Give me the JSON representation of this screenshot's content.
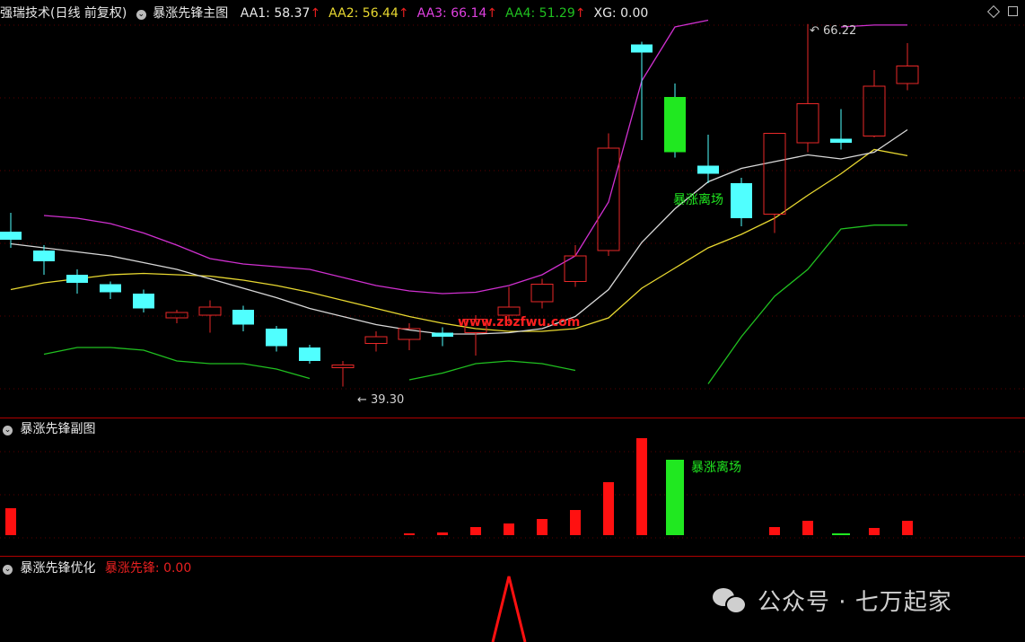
{
  "main_panel": {
    "title": "强瑞技术(日线 前复权)",
    "indicator": "暴涨先锋主图",
    "items": [
      {
        "label": "AA1: 58.37",
        "arrow": "↑",
        "color": "#e8e8e8"
      },
      {
        "label": "AA2: 56.44",
        "arrow": "↑",
        "color": "#e8d830"
      },
      {
        "label": "AA3: 66.14",
        "arrow": "↑",
        "color": "#e040e0"
      },
      {
        "label": "AA4: 51.29",
        "arrow": "↑",
        "color": "#20c020"
      },
      {
        "label": "XG: 0.00",
        "arrow": "",
        "color": "#e8e8e8"
      }
    ],
    "high_label": "66.22",
    "low_label": "39.30",
    "signal_label": "暴涨离场",
    "watermark": "www.zbzfwu.com"
  },
  "sub_panel": {
    "title": "暴涨先锋副图",
    "signal_label": "暴涨离场"
  },
  "opt_panel": {
    "title": "暴涨先锋优化",
    "item_label": "暴涨先锋: 0.00"
  },
  "wechat": {
    "text": "公众号 · 七万起家"
  },
  "chart_data": {
    "type": "candlestick",
    "candles": [
      {
        "o": 50.8,
        "c": 50.2,
        "h": 52.2,
        "l": 49.6
      },
      {
        "o": 49.4,
        "c": 48.6,
        "h": 49.8,
        "l": 47.6
      },
      {
        "o": 47.6,
        "c": 47.0,
        "h": 48.0,
        "l": 46.2
      },
      {
        "o": 46.9,
        "c": 46.3,
        "h": 47.1,
        "l": 45.8
      },
      {
        "o": 46.2,
        "c": 45.1,
        "h": 46.5,
        "l": 44.8
      },
      {
        "o": 44.4,
        "c": 44.8,
        "h": 45.0,
        "l": 44.0
      },
      {
        "o": 44.6,
        "c": 45.2,
        "h": 45.7,
        "l": 43.3
      },
      {
        "o": 45.0,
        "c": 43.9,
        "h": 45.3,
        "l": 43.4
      },
      {
        "o": 43.6,
        "c": 42.3,
        "h": 43.8,
        "l": 41.9
      },
      {
        "o": 42.2,
        "c": 41.2,
        "h": 42.4,
        "l": 41.0
      },
      {
        "o": 40.7,
        "c": 40.9,
        "h": 41.2,
        "l": 39.3
      },
      {
        "o": 42.5,
        "c": 43.0,
        "h": 43.4,
        "l": 41.9
      },
      {
        "o": 42.8,
        "c": 43.6,
        "h": 44.0,
        "l": 42.0
      },
      {
        "o": 43.3,
        "c": 43.0,
        "h": 43.7,
        "l": 42.3
      },
      {
        "o": 43.3,
        "c": 44.3,
        "h": 44.6,
        "l": 41.6
      },
      {
        "o": 44.6,
        "c": 45.2,
        "h": 46.7,
        "l": 44.0
      },
      {
        "o": 45.6,
        "c": 46.9,
        "h": 47.3,
        "l": 45.1
      },
      {
        "o": 47.1,
        "c": 49.0,
        "h": 49.8,
        "l": 46.7
      },
      {
        "o": 49.4,
        "c": 57.0,
        "h": 58.1,
        "l": 49.0
      },
      {
        "o": 64.7,
        "c": 64.1,
        "h": 64.9,
        "l": 57.6
      },
      {
        "o": 60.8,
        "c": 56.7,
        "h": 61.8,
        "l": 56.3
      },
      {
        "o": 55.7,
        "c": 55.1,
        "h": 58.0,
        "l": 54.4
      },
      {
        "o": 54.4,
        "c": 51.8,
        "h": 54.8,
        "l": 51.2
      },
      {
        "o": 52.1,
        "c": 58.1,
        "h": 58.1,
        "l": 50.7
      },
      {
        "o": 57.4,
        "c": 60.3,
        "h": 66.22,
        "l": 56.7
      },
      {
        "o": 57.7,
        "c": 57.4,
        "h": 59.9,
        "l": 56.9
      },
      {
        "o": 57.9,
        "c": 61.6,
        "h": 62.8,
        "l": 57.8
      },
      {
        "o": 61.8,
        "c": 63.1,
        "h": 64.8,
        "l": 61.3
      }
    ],
    "aa1": [
      49.9,
      49.6,
      49.3,
      49.0,
      48.5,
      48.0,
      47.3,
      46.6,
      45.9,
      45.1,
      44.5,
      43.9,
      43.5,
      43.2,
      43.2,
      43.3,
      43.6,
      44.5,
      46.5,
      50.0,
      52.5,
      54.5,
      55.5,
      56.0,
      56.5,
      56.2,
      56.7,
      58.37
    ],
    "aa2": [
      46.5,
      47.0,
      47.3,
      47.6,
      47.7,
      47.6,
      47.5,
      47.2,
      46.8,
      46.3,
      45.7,
      45.1,
      44.5,
      44.0,
      43.6,
      43.4,
      43.4,
      43.6,
      44.4,
      46.6,
      48.1,
      49.6,
      50.6,
      51.8,
      53.5,
      55.1,
      56.9,
      56.44
    ],
    "aa3": [
      null,
      52.0,
      51.8,
      51.4,
      50.7,
      49.8,
      48.8,
      48.4,
      48.2,
      48.0,
      47.4,
      46.8,
      46.4,
      46.2,
      46.3,
      46.8,
      47.6,
      49.0,
      53.0,
      62.0,
      66.0,
      66.5,
      null,
      null,
      null,
      66.0,
      66.14,
      66.14
    ],
    "aa4": [
      null,
      41.7,
      42.2,
      42.2,
      42.0,
      41.2,
      41.0,
      41.0,
      40.6,
      39.9,
      null,
      null,
      39.8,
      40.3,
      41.0,
      41.2,
      41.0,
      40.5,
      null,
      null,
      null,
      39.5,
      43.0,
      46.0,
      48.0,
      51.0,
      51.29,
      51.29
    ],
    "sub_bars": [
      {
        "i": 0,
        "v": 30,
        "color": "red"
      },
      {
        "i": 12,
        "v": 2,
        "color": "red"
      },
      {
        "i": 13,
        "v": 3,
        "color": "red"
      },
      {
        "i": 14,
        "v": 9,
        "color": "red"
      },
      {
        "i": 15,
        "v": 13,
        "color": "red"
      },
      {
        "i": 16,
        "v": 18,
        "color": "red"
      },
      {
        "i": 17,
        "v": 28,
        "color": "red"
      },
      {
        "i": 18,
        "v": 59,
        "color": "red"
      },
      {
        "i": 19,
        "v": 108,
        "color": "red"
      },
      {
        "i": 20,
        "v": 84,
        "color": "green"
      },
      {
        "i": 23,
        "v": 9,
        "color": "red"
      },
      {
        "i": 24,
        "v": 16,
        "color": "red"
      },
      {
        "i": 25,
        "v": 2,
        "color": "green"
      },
      {
        "i": 26,
        "v": 8,
        "color": "red"
      },
      {
        "i": 27,
        "v": 16,
        "color": "red"
      }
    ],
    "opt_signal_index": 15
  }
}
